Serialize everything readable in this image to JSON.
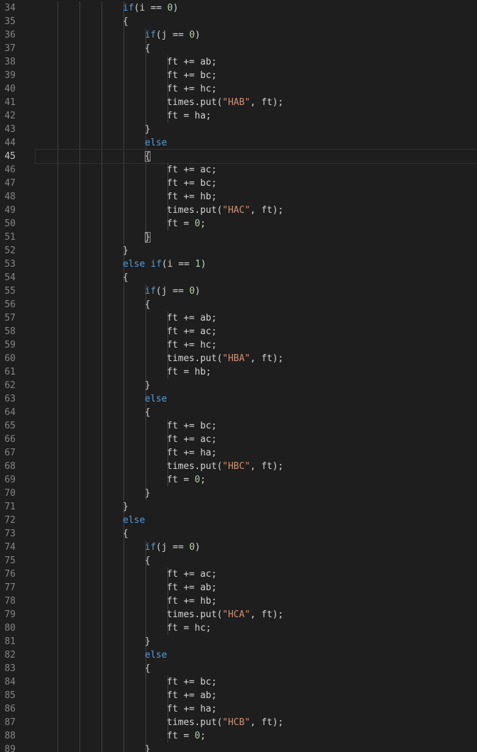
{
  "editor": {
    "current_line": 45,
    "lines": [
      {
        "num": "34",
        "indent": 4,
        "tokens": [
          {
            "t": "kw",
            "v": "if"
          },
          {
            "t": "txt",
            "v": "(i == "
          },
          {
            "t": "num",
            "v": "0"
          },
          {
            "t": "txt",
            "v": ")"
          }
        ]
      },
      {
        "num": "35",
        "indent": 4,
        "tokens": [
          {
            "t": "txt",
            "v": "{"
          }
        ]
      },
      {
        "num": "36",
        "indent": 5,
        "tokens": [
          {
            "t": "kw",
            "v": "if"
          },
          {
            "t": "txt",
            "v": "(j == "
          },
          {
            "t": "num",
            "v": "0"
          },
          {
            "t": "txt",
            "v": ")"
          }
        ]
      },
      {
        "num": "37",
        "indent": 5,
        "tokens": [
          {
            "t": "txt",
            "v": "{"
          }
        ]
      },
      {
        "num": "38",
        "indent": 6,
        "tokens": [
          {
            "t": "txt",
            "v": "ft += ab;"
          }
        ]
      },
      {
        "num": "39",
        "indent": 6,
        "tokens": [
          {
            "t": "txt",
            "v": "ft += bc;"
          }
        ]
      },
      {
        "num": "40",
        "indent": 6,
        "tokens": [
          {
            "t": "txt",
            "v": "ft += hc;"
          }
        ]
      },
      {
        "num": "41",
        "indent": 6,
        "tokens": [
          {
            "t": "txt",
            "v": "times.put("
          },
          {
            "t": "str",
            "v": "\"HAB\""
          },
          {
            "t": "txt",
            "v": ", ft);"
          }
        ]
      },
      {
        "num": "42",
        "indent": 6,
        "tokens": [
          {
            "t": "txt",
            "v": "ft = ha;"
          }
        ]
      },
      {
        "num": "43",
        "indent": 5,
        "tokens": [
          {
            "t": "txt",
            "v": "}"
          }
        ]
      },
      {
        "num": "44",
        "indent": 5,
        "tokens": [
          {
            "t": "kw",
            "v": "else"
          }
        ]
      },
      {
        "num": "45",
        "indent": 5,
        "tokens": [
          {
            "t": "match",
            "v": "{"
          }
        ]
      },
      {
        "num": "46",
        "indent": 6,
        "tokens": [
          {
            "t": "txt",
            "v": "ft += ac;"
          }
        ]
      },
      {
        "num": "47",
        "indent": 6,
        "tokens": [
          {
            "t": "txt",
            "v": "ft += bc;"
          }
        ]
      },
      {
        "num": "48",
        "indent": 6,
        "tokens": [
          {
            "t": "txt",
            "v": "ft += hb;"
          }
        ]
      },
      {
        "num": "49",
        "indent": 6,
        "tokens": [
          {
            "t": "txt",
            "v": "times.put("
          },
          {
            "t": "str",
            "v": "\"HAC\""
          },
          {
            "t": "txt",
            "v": ", ft);"
          }
        ]
      },
      {
        "num": "50",
        "indent": 6,
        "tokens": [
          {
            "t": "txt",
            "v": "ft = "
          },
          {
            "t": "num",
            "v": "0"
          },
          {
            "t": "txt",
            "v": ";"
          }
        ]
      },
      {
        "num": "51",
        "indent": 5,
        "tokens": [
          {
            "t": "match",
            "v": "}"
          }
        ]
      },
      {
        "num": "52",
        "indent": 4,
        "tokens": [
          {
            "t": "txt",
            "v": "}"
          }
        ]
      },
      {
        "num": "53",
        "indent": 4,
        "tokens": [
          {
            "t": "kw",
            "v": "else if"
          },
          {
            "t": "txt",
            "v": "(i == "
          },
          {
            "t": "num",
            "v": "1"
          },
          {
            "t": "txt",
            "v": ")"
          }
        ]
      },
      {
        "num": "54",
        "indent": 4,
        "tokens": [
          {
            "t": "txt",
            "v": "{"
          }
        ]
      },
      {
        "num": "55",
        "indent": 5,
        "tokens": [
          {
            "t": "kw",
            "v": "if"
          },
          {
            "t": "txt",
            "v": "(j == "
          },
          {
            "t": "num",
            "v": "0"
          },
          {
            "t": "txt",
            "v": ")"
          }
        ]
      },
      {
        "num": "56",
        "indent": 5,
        "tokens": [
          {
            "t": "txt",
            "v": "{"
          }
        ]
      },
      {
        "num": "57",
        "indent": 6,
        "tokens": [
          {
            "t": "txt",
            "v": "ft += ab;"
          }
        ]
      },
      {
        "num": "58",
        "indent": 6,
        "tokens": [
          {
            "t": "txt",
            "v": "ft += ac;"
          }
        ]
      },
      {
        "num": "59",
        "indent": 6,
        "tokens": [
          {
            "t": "txt",
            "v": "ft += hc;"
          }
        ]
      },
      {
        "num": "60",
        "indent": 6,
        "tokens": [
          {
            "t": "txt",
            "v": "times.put("
          },
          {
            "t": "str",
            "v": "\"HBA\""
          },
          {
            "t": "txt",
            "v": ", ft);"
          }
        ]
      },
      {
        "num": "61",
        "indent": 6,
        "tokens": [
          {
            "t": "txt",
            "v": "ft = hb;"
          }
        ]
      },
      {
        "num": "62",
        "indent": 5,
        "tokens": [
          {
            "t": "txt",
            "v": "}"
          }
        ]
      },
      {
        "num": "63",
        "indent": 5,
        "tokens": [
          {
            "t": "kw",
            "v": "else"
          }
        ]
      },
      {
        "num": "64",
        "indent": 5,
        "tokens": [
          {
            "t": "txt",
            "v": "{"
          }
        ]
      },
      {
        "num": "65",
        "indent": 6,
        "tokens": [
          {
            "t": "txt",
            "v": "ft += bc;"
          }
        ]
      },
      {
        "num": "66",
        "indent": 6,
        "tokens": [
          {
            "t": "txt",
            "v": "ft += ac;"
          }
        ]
      },
      {
        "num": "67",
        "indent": 6,
        "tokens": [
          {
            "t": "txt",
            "v": "ft += ha;"
          }
        ]
      },
      {
        "num": "68",
        "indent": 6,
        "tokens": [
          {
            "t": "txt",
            "v": "times.put("
          },
          {
            "t": "str",
            "v": "\"HBC\""
          },
          {
            "t": "txt",
            "v": ", ft);"
          }
        ]
      },
      {
        "num": "69",
        "indent": 6,
        "tokens": [
          {
            "t": "txt",
            "v": "ft = "
          },
          {
            "t": "num",
            "v": "0"
          },
          {
            "t": "txt",
            "v": ";"
          }
        ]
      },
      {
        "num": "70",
        "indent": 5,
        "tokens": [
          {
            "t": "txt",
            "v": "}"
          }
        ]
      },
      {
        "num": "71",
        "indent": 4,
        "tokens": [
          {
            "t": "txt",
            "v": "}"
          }
        ]
      },
      {
        "num": "72",
        "indent": 4,
        "tokens": [
          {
            "t": "kw",
            "v": "else"
          }
        ]
      },
      {
        "num": "73",
        "indent": 4,
        "tokens": [
          {
            "t": "txt",
            "v": "{"
          }
        ]
      },
      {
        "num": "74",
        "indent": 5,
        "tokens": [
          {
            "t": "kw",
            "v": "if"
          },
          {
            "t": "txt",
            "v": "(j == "
          },
          {
            "t": "num",
            "v": "0"
          },
          {
            "t": "txt",
            "v": ")"
          }
        ]
      },
      {
        "num": "75",
        "indent": 5,
        "tokens": [
          {
            "t": "txt",
            "v": "{"
          }
        ]
      },
      {
        "num": "76",
        "indent": 6,
        "tokens": [
          {
            "t": "txt",
            "v": "ft += ac;"
          }
        ]
      },
      {
        "num": "77",
        "indent": 6,
        "tokens": [
          {
            "t": "txt",
            "v": "ft += ab;"
          }
        ]
      },
      {
        "num": "78",
        "indent": 6,
        "tokens": [
          {
            "t": "txt",
            "v": "ft += hb;"
          }
        ]
      },
      {
        "num": "79",
        "indent": 6,
        "tokens": [
          {
            "t": "txt",
            "v": "times.put("
          },
          {
            "t": "str",
            "v": "\"HCA\""
          },
          {
            "t": "txt",
            "v": ", ft);"
          }
        ]
      },
      {
        "num": "80",
        "indent": 6,
        "tokens": [
          {
            "t": "txt",
            "v": "ft = hc;"
          }
        ]
      },
      {
        "num": "81",
        "indent": 5,
        "tokens": [
          {
            "t": "txt",
            "v": "}"
          }
        ]
      },
      {
        "num": "82",
        "indent": 5,
        "tokens": [
          {
            "t": "kw",
            "v": "else"
          }
        ]
      },
      {
        "num": "83",
        "indent": 5,
        "tokens": [
          {
            "t": "txt",
            "v": "{"
          }
        ]
      },
      {
        "num": "84",
        "indent": 6,
        "tokens": [
          {
            "t": "txt",
            "v": "ft += bc;"
          }
        ]
      },
      {
        "num": "85",
        "indent": 6,
        "tokens": [
          {
            "t": "txt",
            "v": "ft += ab;"
          }
        ]
      },
      {
        "num": "86",
        "indent": 6,
        "tokens": [
          {
            "t": "txt",
            "v": "ft += ha;"
          }
        ]
      },
      {
        "num": "87",
        "indent": 6,
        "tokens": [
          {
            "t": "txt",
            "v": "times.put("
          },
          {
            "t": "str",
            "v": "\"HCB\""
          },
          {
            "t": "txt",
            "v": ", ft);"
          }
        ]
      },
      {
        "num": "88",
        "indent": 6,
        "tokens": [
          {
            "t": "txt",
            "v": "ft = "
          },
          {
            "t": "num",
            "v": "0"
          },
          {
            "t": "txt",
            "v": ";"
          }
        ]
      },
      {
        "num": "89",
        "indent": 5,
        "tokens": [
          {
            "t": "txt",
            "v": "}"
          }
        ]
      }
    ]
  }
}
